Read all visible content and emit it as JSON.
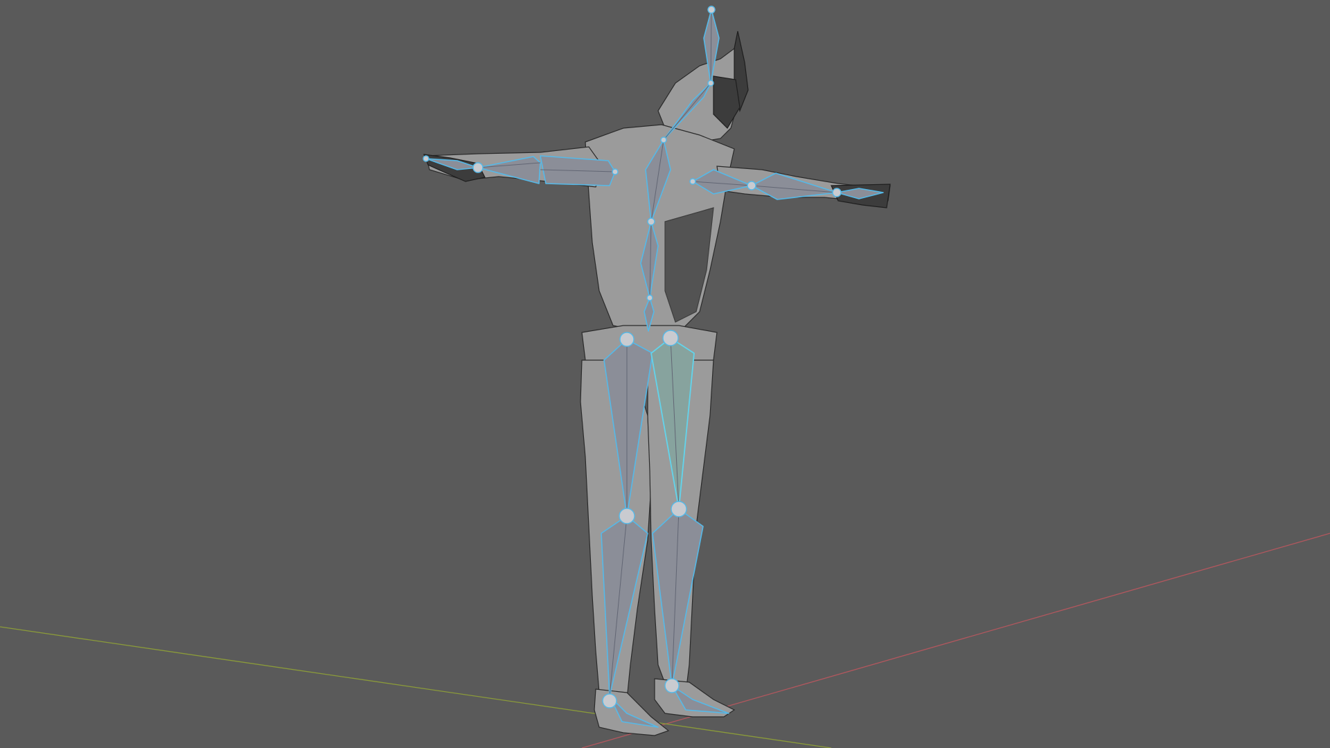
{
  "viewport": {
    "mode": "pose-armature",
    "background_color": "#5a5a5a"
  },
  "axes": {
    "x_axis_color": "#b3575e",
    "y_axis_color": "#8b9b3a"
  },
  "armature": {
    "bone_color": "#8b8e98",
    "bone_outline_color": "#55b9e8",
    "active_bone_color": "#87a39e",
    "bones": [
      "head",
      "neck",
      "spine-upper",
      "spine-lower",
      "upper-arm-left",
      "forearm-left",
      "hand-left",
      "upper-arm-right",
      "forearm-right",
      "hand-right",
      "thigh-left",
      "shin-left",
      "foot-left",
      "thigh-right",
      "shin-right",
      "foot-right"
    ],
    "active_bone": "thigh-right"
  },
  "mesh": {
    "wireframe_color": "#2a2a2a",
    "surface_color": "#9b9b9b"
  }
}
